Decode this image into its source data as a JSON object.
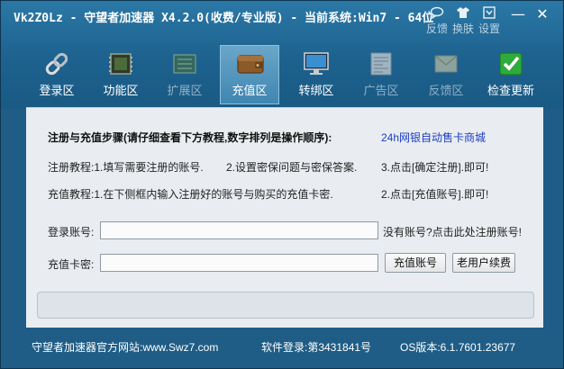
{
  "titlebar": {
    "title": "Vk2Z0Lz  - 守望者加速器 X4.2.0(收费/专业版) - 当前系统:Win7 - 64位",
    "buttons": [
      {
        "label": "反馈",
        "icon": "chat-bubble-icon"
      },
      {
        "label": "换肤",
        "icon": "shirt-icon"
      },
      {
        "label": "设置",
        "icon": "settings-box-icon"
      }
    ],
    "minimize": "—",
    "close": "✕"
  },
  "toolbar": {
    "items": [
      {
        "label": "登录区",
        "icon": "chain-link-icon",
        "dim": false
      },
      {
        "label": "功能区",
        "icon": "chip-icon",
        "dim": false
      },
      {
        "label": "扩展区",
        "icon": "board-icon",
        "dim": true
      },
      {
        "label": "充值区",
        "icon": "wallet-icon",
        "dim": false,
        "active": true
      },
      {
        "label": "转绑区",
        "icon": "monitor-icon",
        "dim": false
      },
      {
        "label": "广告区",
        "icon": "newspaper-icon",
        "dim": true
      },
      {
        "label": "反馈区",
        "icon": "envelope-icon",
        "dim": true
      },
      {
        "label": "检查更新",
        "icon": "check-mark-icon",
        "dim": false
      }
    ]
  },
  "content": {
    "steps_title": "注册与充值步骤(请仔细查看下方教程,数字排列是操作顺序):",
    "shop_link": "24h网银自动售卡商城",
    "register": {
      "s1": "注册教程:1.填写需要注册的账号.",
      "s2": "2.设置密保问题与密保答案.",
      "s3": "3.点击[确定注册].即可!"
    },
    "recharge": {
      "s1": "充值教程:1.在下侧框内输入注册好的账号与购买的充值卡密.",
      "s2": "2.点击[充值账号].即可!"
    },
    "account_label": "登录账号:",
    "account_value": "",
    "register_link": "没有账号?点击此处注册账号!",
    "card_label": "充值卡密:",
    "card_value": "",
    "recharge_button": "充值账号",
    "renew_button": "老用户续费"
  },
  "footer": {
    "website": "守望者加速器官方网站:www.Swz7.com",
    "login_count": "软件登录:第3431841号",
    "os_version": "OS版本:6.1.7601.23677"
  }
}
